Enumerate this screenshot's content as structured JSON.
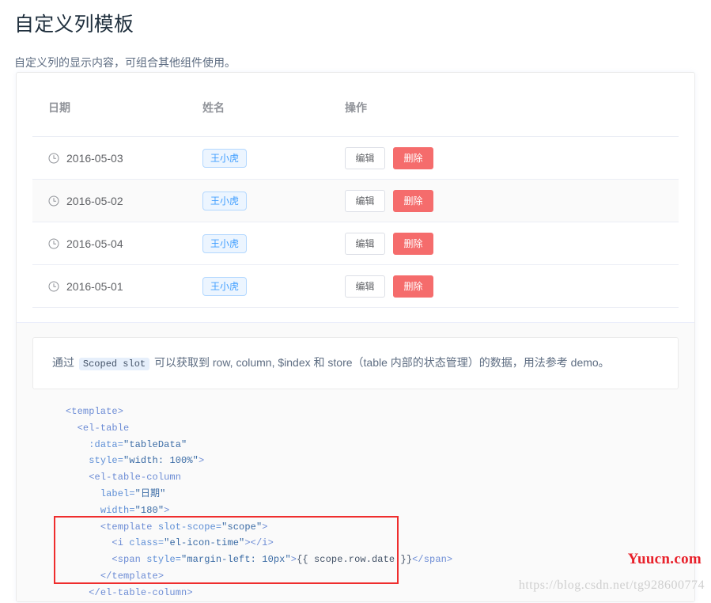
{
  "page": {
    "title": "自定义列模板",
    "description": "自定义列的显示内容，可组合其他组件使用。"
  },
  "table": {
    "columns": [
      {
        "key": "date",
        "label": "日期"
      },
      {
        "key": "name",
        "label": "姓名"
      },
      {
        "key": "ops",
        "label": "操作"
      }
    ],
    "rows": [
      {
        "date": "2016-05-03",
        "name": "王小虎",
        "edit": "编辑",
        "delete": "删除",
        "striped": false
      },
      {
        "date": "2016-05-02",
        "name": "王小虎",
        "edit": "编辑",
        "delete": "删除",
        "striped": true
      },
      {
        "date": "2016-05-04",
        "name": "王小虎",
        "edit": "编辑",
        "delete": "删除",
        "striped": false
      },
      {
        "date": "2016-05-01",
        "name": "王小虎",
        "edit": "编辑",
        "delete": "删除",
        "striped": false
      }
    ],
    "icons": {
      "date": "clock-icon"
    }
  },
  "description_box": {
    "prefix": "通过",
    "code": "Scoped slot",
    "suffix": "可以获取到 row, column, $index 和 store（table 内部的状态管理）的数据，用法参考 demo。"
  },
  "code_block": {
    "lines": [
      [
        {
          "t": "tag",
          "s": "<template>"
        }
      ],
      [
        {
          "t": "plain",
          "s": "  "
        },
        {
          "t": "tag",
          "s": "<el-table"
        }
      ],
      [
        {
          "t": "plain",
          "s": "    "
        },
        {
          "t": "attr",
          "s": ":data="
        },
        {
          "t": "str",
          "s": "\"tableData\""
        }
      ],
      [
        {
          "t": "plain",
          "s": "    "
        },
        {
          "t": "attr",
          "s": "style="
        },
        {
          "t": "str",
          "s": "\"width: 100%\""
        },
        {
          "t": "tag",
          "s": ">"
        }
      ],
      [
        {
          "t": "plain",
          "s": "    "
        },
        {
          "t": "tag",
          "s": "<el-table-column"
        }
      ],
      [
        {
          "t": "plain",
          "s": "      "
        },
        {
          "t": "attr",
          "s": "label="
        },
        {
          "t": "str",
          "s": "\"日期\""
        }
      ],
      [
        {
          "t": "plain",
          "s": "      "
        },
        {
          "t": "attr",
          "s": "width="
        },
        {
          "t": "str",
          "s": "\"180\""
        },
        {
          "t": "tag",
          "s": ">"
        }
      ],
      [
        {
          "t": "plain",
          "s": "      "
        },
        {
          "t": "tag",
          "s": "<template "
        },
        {
          "t": "attr",
          "s": "slot-scope="
        },
        {
          "t": "str",
          "s": "\"scope\""
        },
        {
          "t": "tag",
          "s": ">"
        }
      ],
      [
        {
          "t": "plain",
          "s": "        "
        },
        {
          "t": "tag",
          "s": "<i "
        },
        {
          "t": "attr",
          "s": "class="
        },
        {
          "t": "str",
          "s": "\"el-icon-time\""
        },
        {
          "t": "tag",
          "s": "></i>"
        }
      ],
      [
        {
          "t": "plain",
          "s": "        "
        },
        {
          "t": "tag",
          "s": "<span "
        },
        {
          "t": "attr",
          "s": "style="
        },
        {
          "t": "str",
          "s": "\"margin-left: 10px\""
        },
        {
          "t": "tag",
          "s": ">"
        },
        {
          "t": "mustache",
          "s": "{{ scope.row.date }}"
        },
        {
          "t": "tag",
          "s": "</span>"
        }
      ],
      [
        {
          "t": "plain",
          "s": "      "
        },
        {
          "t": "tag",
          "s": "</template>"
        }
      ],
      [
        {
          "t": "plain",
          "s": "    "
        },
        {
          "t": "tag",
          "s": "</el-table-column>"
        }
      ]
    ]
  },
  "watermarks": {
    "brand": "Yuucn.com",
    "url": "https://blog.csdn.net/tg928600774"
  },
  "colors": {
    "accent_blue": "#409eff",
    "tag_bg": "#ecf5ff",
    "tag_border": "#b3d8ff",
    "danger": "#f56c6c",
    "header_text": "#909399",
    "title_text": "#1f2f3d",
    "body_text": "#5e6d82",
    "annotation_red": "#ef2d2d",
    "watermark_red": "#e8202a",
    "watermark_gray": "#cfcfcf",
    "stripe_bg": "#fafafa"
  }
}
